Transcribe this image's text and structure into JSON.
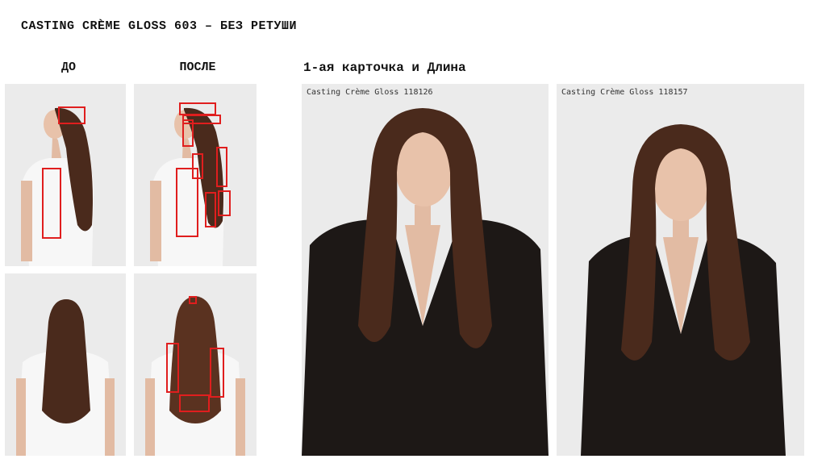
{
  "slide": {
    "title": "CASTING CRÈME GLOSS 603 – БЕЗ РЕТУШИ",
    "before_label": "ДО",
    "after_label": "ПОСЛЕ",
    "section_label": "1-ая карточка и Длина"
  },
  "cards": [
    {
      "label": "Casting Crème Gloss 118126"
    },
    {
      "label": "Casting Crème Gloss 118157"
    }
  ],
  "colors": {
    "marker": "#e01e1e",
    "hair": "#4a2a1c",
    "jacket": "#1d1816",
    "background": "#ebebeb"
  }
}
